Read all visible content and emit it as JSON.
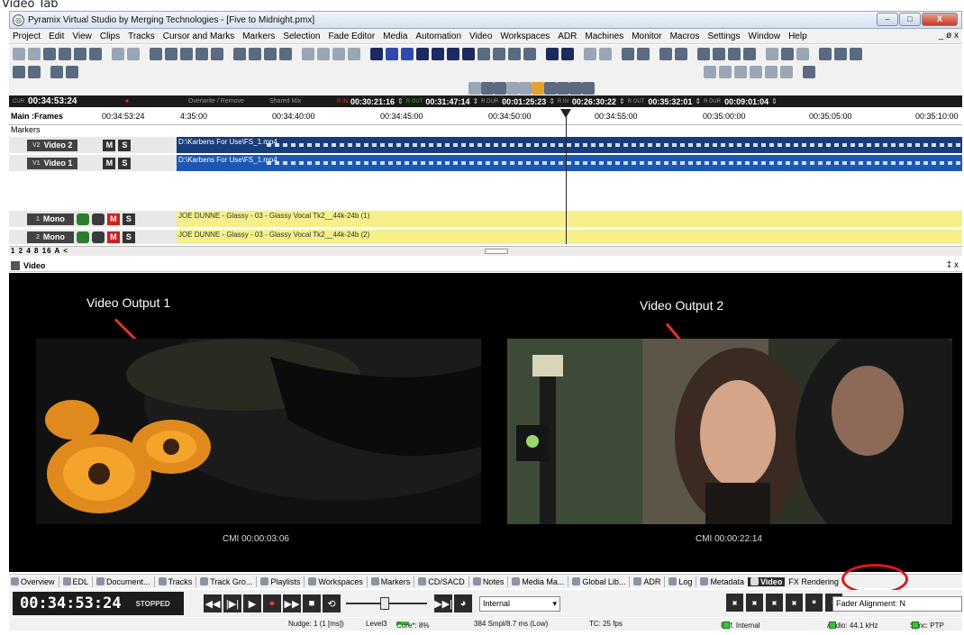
{
  "caption": "Video Tab",
  "window": {
    "title": "Pyramix Virtual Studio by Merging Technologies - [Five to Midnight.pmx]",
    "minimize": "–",
    "maximize": "□",
    "close": "X"
  },
  "menu": [
    "Project",
    "Edit",
    "View",
    "Clips",
    "Tracks",
    "Cursor and Marks",
    "Markers",
    "Selection",
    "Fade Editor",
    "Media",
    "Automation",
    "Video",
    "Workspaces",
    "ADR",
    "Machines",
    "Monitor",
    "Macros",
    "Settings",
    "Window",
    "Help"
  ],
  "menu_mdi": "_ ø x",
  "timecodes": {
    "cur_label": "CUR",
    "cur": "00:34:53:24",
    "overwrite": "Overwrite / Remove",
    "shared": "Shared Mix",
    "in_label": "R IN",
    "in": "00:30:21:16",
    "out_label": "R OUT",
    "out": "00:31:47:14",
    "dur_label": "R DUR",
    "dur": "00:01:25:23",
    "in2_label": "R IN",
    "in2": "00:26:30:22",
    "out2_label": "R OUT",
    "out2": "00:35:32:01",
    "dur2_label": "R DUR",
    "dur2": "00:09:01:04"
  },
  "ruler": {
    "label": "Main :Frames",
    "current": "00:34:53:24",
    "ticks": [
      "4:35:00",
      "00:34:40:00",
      "00:34:45:00",
      "00:34:50:00",
      "00:34:55:00",
      "00:35:00:00",
      "00:35:05:00",
      "00:35:10:00"
    ]
  },
  "markers_label": "Markers",
  "tracks": [
    {
      "num": "V2",
      "name": "Video 2",
      "m": "M",
      "s": "S",
      "clip": "D:\\Karbens For Use\\FS_1.mp4"
    },
    {
      "num": "V1",
      "name": "Video 1",
      "m": "M",
      "s": "S",
      "clip": "D:\\Karbens For Use\\FS_1.mp4"
    },
    {
      "num": "1",
      "name": "Mono",
      "m": "M",
      "s": "S",
      "clip": "JOE DUNNE - Glassy - 03 - Glassy Vocal Tk2__44k-24b (1)"
    },
    {
      "num": "2",
      "name": "Mono",
      "m": "M",
      "s": "S",
      "clip": "JOE DUNNE - Glassy - 03 - Glassy Vocal Tk2__44k-24b (2)"
    }
  ],
  "zoom_buttons": "1 2 4 8 16 A <",
  "video_panel": {
    "title": "Video",
    "pin": "‡ x",
    "output1": "Video Output 1",
    "output2": "Video Output 2",
    "tc1": "CMI 00:00:03:06",
    "tc2": "CMI 00:00:22:14"
  },
  "bottom_tabs": [
    "Overview",
    "EDL",
    "Document...",
    "Tracks",
    "Track Gro...",
    "Playlists",
    "Workspaces",
    "Markers",
    "CD/SACD",
    "Notes",
    "Media Ma...",
    "Global Lib...",
    "ADR",
    "Log",
    "Metadata",
    "Video",
    "FX Rendering"
  ],
  "active_tab": "Video",
  "transport": {
    "clock": "00:34:53:24",
    "state": "STOPPED",
    "sync_source": "Internal",
    "fader_alignment": "Fader Alignment: N"
  },
  "status": {
    "nudge": "Nudge: 1 (1 [ms])",
    "level": "Level3",
    "core": "Core*: 8%",
    "buffer": "384 Smpl/8.7 ms (Low)",
    "tc": "TC: 25 fps",
    "ref": "Ref. Internal",
    "audio": "Audio: 44.1 kHz",
    "sync": "Sync: PTP"
  },
  "colors": {
    "pointer": "#e8312d",
    "highlight_circle": "#e0161b",
    "video2_lane": "#183d7a",
    "video1_lane": "#1d57b4",
    "audio_lane": "#f5f08a"
  }
}
